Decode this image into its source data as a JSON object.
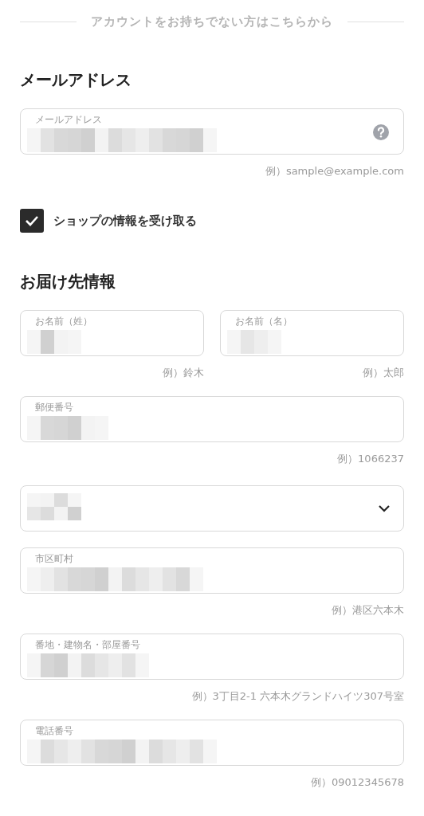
{
  "divider_text": "アカウントをお持ちでない方はこちらから",
  "sections": [
    {
      "heading": "メールアドレス",
      "items": [
        {
          "kind": "field",
          "fields": [
            {
              "label": "メールアドレス",
              "obscured": true,
              "help_icon": true,
              "hint": "例）sample@example.com"
            }
          ]
        },
        {
          "kind": "checkbox",
          "label": "ショップの情報を受け取る",
          "checked": true
        }
      ]
    },
    {
      "heading": "お届け先情報",
      "items": [
        {
          "kind": "field",
          "fields": [
            {
              "label": "お名前（姓）",
              "obscured": true,
              "hint": "例）鈴木"
            },
            {
              "label": "お名前（名）",
              "obscured": true,
              "hint": "例）太郎"
            }
          ]
        },
        {
          "kind": "field",
          "fields": [
            {
              "label": "郵便番号",
              "obscured": true,
              "hint": "例）1066237"
            }
          ]
        },
        {
          "kind": "select",
          "obscured": true
        },
        {
          "kind": "field",
          "fields": [
            {
              "label": "市区町村",
              "obscured": true,
              "hint": "例）港区六本木"
            }
          ]
        },
        {
          "kind": "field",
          "fields": [
            {
              "label": "番地・建物名・部屋番号",
              "obscured": true,
              "hint": "例）3丁目2-1 六本木グランドハイツ307号室"
            }
          ]
        },
        {
          "kind": "field",
          "fields": [
            {
              "label": "電話番号",
              "obscured": true,
              "hint": "例）09012345678"
            }
          ]
        }
      ]
    }
  ]
}
